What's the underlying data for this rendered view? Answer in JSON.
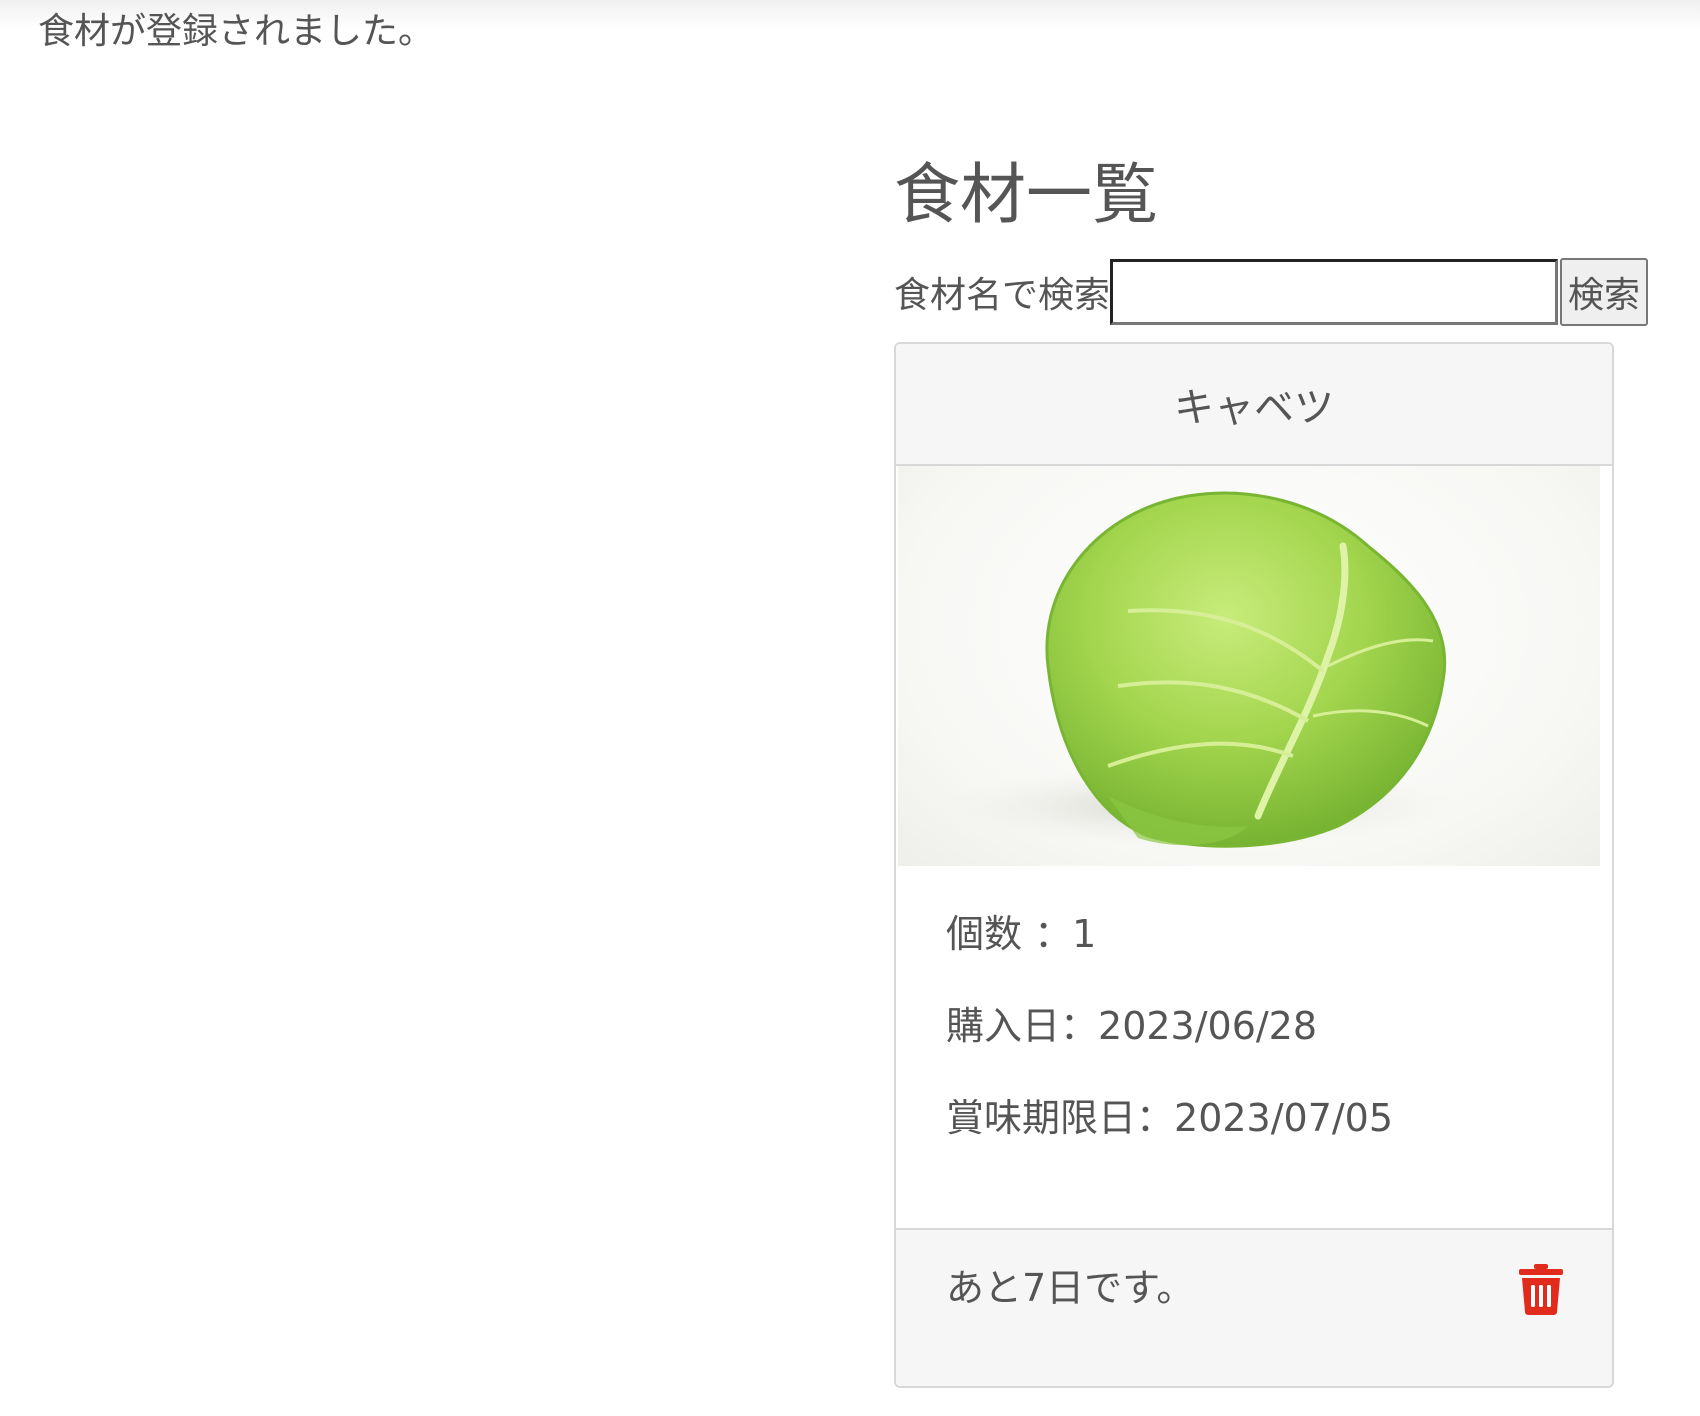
{
  "flash_message": "食材が登録されました。",
  "page": {
    "heading": "食材一覧"
  },
  "search": {
    "label": "食材名で検索",
    "value": "",
    "placeholder": "",
    "button_label": "検索"
  },
  "card": {
    "name": "キャベツ",
    "image_alt": "キャベツ",
    "quantity_label": "個数 ：",
    "quantity_value": "1",
    "purchase_label": "購入日：",
    "purchase_date": "2023/06/28",
    "expiry_label": "賞味期限日：",
    "expiry_date": "2023/07/05",
    "remaining_text": "あと7日です。",
    "delete_icon": "trash-icon"
  },
  "colors": {
    "delete_icon": "#e02b1d",
    "card_header_bg": "#f6f6f6",
    "text": "#555555"
  }
}
